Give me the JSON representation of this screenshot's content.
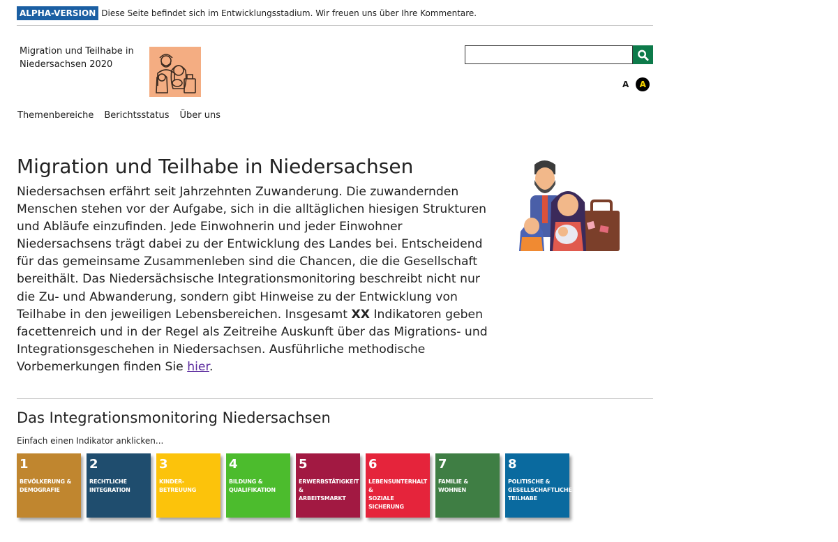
{
  "banner": {
    "badge": "ALPHA-VERSION",
    "text": "Diese Seite befindet sich im Entwicklungsstadium. Wir freuen uns über Ihre Kommentare."
  },
  "brand": {
    "title_line1": "Migration und Teilhabe in",
    "title_line2": "Niedersachsen 2020"
  },
  "search": {
    "value": "",
    "placeholder": ""
  },
  "accessibility": {
    "font_label": "A",
    "contrast_label": "A"
  },
  "nav": {
    "items": [
      {
        "label": "Themenbereiche"
      },
      {
        "label": "Berichtsstatus"
      },
      {
        "label": "Über uns"
      }
    ]
  },
  "intro": {
    "title": "Migration und Teilhabe in Niedersachsen",
    "text_before": "Niedersachsen erfährt seit Jahrzehnten Zuwanderung. Die zuwandernden Menschen stehen vor der Aufgabe, sich in die alltäglichen hiesigen Strukturen und Abläufe einzufinden. Jede Einwohnerin und jeder Einwohner Niedersachsens trägt dabei zu der Entwicklung des Landes bei. Entscheidend für das gemeinsame Zusammenleben sind die Chancen, die die Gesellschaft bereithält. Das Niedersächsische Integrationsmonitoring beschreibt nicht nur die Zu- und Abwanderung, sondern gibt Hinweise zu der Entwicklung von Teilhabe in den jeweiligen Lebensbereichen. Insgesamt ",
    "highlight": "XX",
    "text_middle": " Indikatoren geben facettenreich und in der Regel als Zeitreihe Auskunft über das Migrations- und Integrationsgeschehen in Niedersachsen. Ausführliche methodische Vorbemerkungen finden Sie ",
    "link": "hier",
    "text_after": "."
  },
  "monitoring": {
    "title": "Das Integrationsmonitoring Niedersachsen",
    "hint": "Einfach einen Indikator anklicken...",
    "tiles": [
      {
        "num": "1",
        "line1": "BEVÖLKERUNG &",
        "line2": "DEMOGRAFIE",
        "line3": "",
        "color": "#c0862f"
      },
      {
        "num": "2",
        "line1": "RECHTLICHE",
        "line2": "INTEGRATION",
        "line3": "",
        "color": "#1f4d6e"
      },
      {
        "num": "3",
        "line1": "KINDER-",
        "line2": "BETREUUNG",
        "line3": "",
        "color": "#fcc30b"
      },
      {
        "num": "4",
        "line1": "BILDUNG &",
        "line2": "QUALIFIKATION",
        "line3": "",
        "color": "#4cbc2d"
      },
      {
        "num": "5",
        "line1": "ERWERBSTÄTIGKEIT &",
        "line2": "ARBEITSMARKT",
        "line3": "",
        "color": "#a21942"
      },
      {
        "num": "6",
        "line1": "LEBENSUNTERHALT &",
        "line2": "SOZIALE SICHERUNG",
        "line3": "",
        "color": "#e5243b"
      },
      {
        "num": "7",
        "line1": "FAMILIE &",
        "line2": "WOHNEN",
        "line3": "",
        "color": "#3f7e44"
      },
      {
        "num": "8",
        "line1": "POLITISCHE &",
        "line2": "GESELLSCHAFTLICHE",
        "line3": "TEILHABE",
        "color": "#0a6a9f"
      }
    ]
  }
}
